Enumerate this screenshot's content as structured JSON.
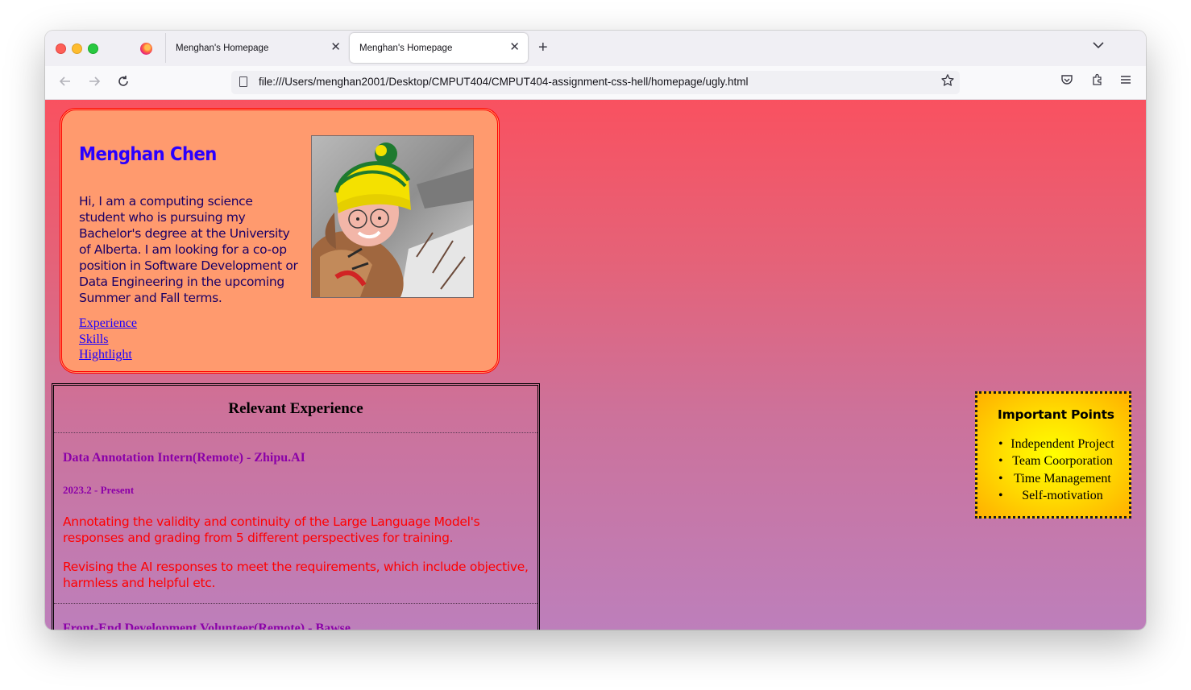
{
  "browser": {
    "tabs": [
      {
        "label": "Menghan's Homepage",
        "active": false
      },
      {
        "label": "Menghan's Homepage",
        "active": true
      }
    ],
    "url": "file:///Users/menghan2001/Desktop/CMPUT404/CMPUT404-assignment-css-hell/homepage/ugly.html"
  },
  "profile": {
    "name": "Menghan Chen",
    "intro": "Hi, I am a computing science student who is pursuing my Bachelor's degree at the University of Alberta. I am looking for a co-op position in Software Development or Data Engineering in the upcoming Summer and Fall terms.",
    "links": [
      "Experience",
      "Skills",
      "Hightlight"
    ]
  },
  "experience": {
    "title": "Relevant Experience",
    "jobs": [
      {
        "title": "Data Annotation Intern(Remote) - Zhipu.AI",
        "date": "2023.2 - Present",
        "duties": [
          "Annotating the validity and continuity of the Large Language Model's responses and grading from 5 different perspectives for training.",
          "Revising the AI responses to meet the requirements, which include objective, harmless and helpful etc."
        ]
      },
      {
        "title": "Front-End Development Volunteer(Remote) - Bawse"
      }
    ]
  },
  "important_points": {
    "title": "Important Points",
    "items": [
      "Independent Project",
      "Team Coorporation",
      "Time Management",
      "Self-motivation"
    ]
  },
  "colors": {
    "page_gradient_top": "#f95160",
    "page_gradient_bottom": "#bd7fbb",
    "card_background": "#ff9a6e",
    "card_border": "#ff0000",
    "name_color": "#2a00ff",
    "job_title_color": "#8b00a8",
    "duty_color": "#ff0000"
  },
  "icons": [
    "firefox-logo-icon",
    "close-icon",
    "plus-icon",
    "chevron-down-icon",
    "back-arrow-icon",
    "forward-arrow-icon",
    "reload-icon",
    "page-icon",
    "star-icon",
    "pocket-icon",
    "extensions-icon",
    "hamburger-menu-icon"
  ]
}
